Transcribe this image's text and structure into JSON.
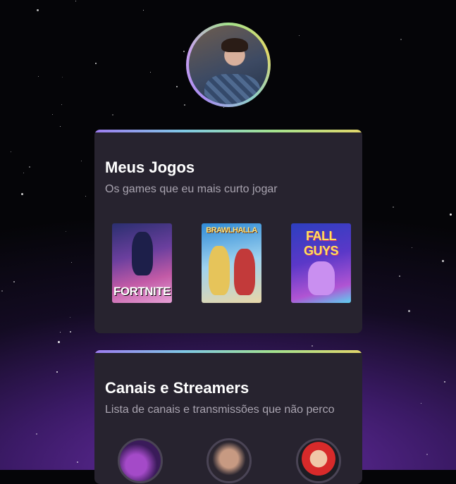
{
  "profile": {
    "avatar_icon": "profile-photo"
  },
  "games_card": {
    "title": "Meus Jogos",
    "subtitle": "Os games que eu mais curto jogar",
    "games": [
      {
        "cover_text": "FORTNITE"
      },
      {
        "cover_text": "BRAWLHALLA"
      },
      {
        "cover_text": "FALL GUYS"
      }
    ]
  },
  "channels_card": {
    "title": "Canais e Streamers",
    "subtitle": "Lista de canais e transmissões que não perco",
    "streamer_icons": [
      "streamer-avatar-1",
      "streamer-avatar-2",
      "streamer-avatar-3"
    ]
  },
  "colors": {
    "card_bg": "#27232f",
    "accent_gradient": [
      "#9d7cf0",
      "#7fc9e6",
      "#a3e28f",
      "#e2d66a"
    ],
    "title": "#ffffff",
    "subtitle": "#a9a4b0"
  }
}
